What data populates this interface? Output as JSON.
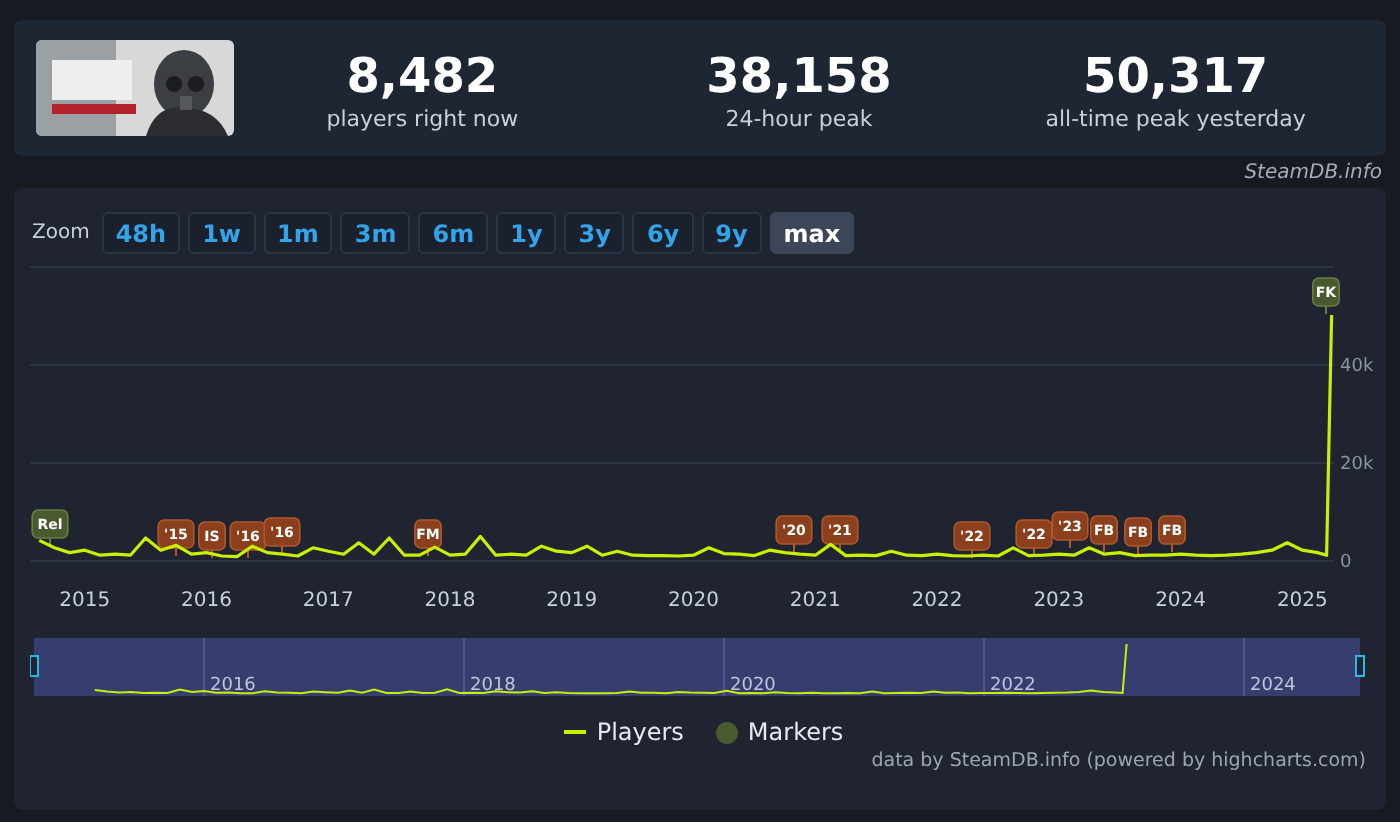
{
  "header": {
    "stats": [
      {
        "value": "8,482",
        "label": "players right now"
      },
      {
        "value": "38,158",
        "label": "24-hour peak"
      },
      {
        "value": "50,317",
        "label": "all-time peak yesterday"
      }
    ],
    "credit": "SteamDB.info"
  },
  "zoom": {
    "label": "Zoom",
    "buttons": [
      {
        "label": "48h",
        "selected": false
      },
      {
        "label": "1w",
        "selected": false
      },
      {
        "label": "1m",
        "selected": false
      },
      {
        "label": "3m",
        "selected": false
      },
      {
        "label": "6m",
        "selected": false
      },
      {
        "label": "1y",
        "selected": false
      },
      {
        "label": "3y",
        "selected": false
      },
      {
        "label": "6y",
        "selected": false
      },
      {
        "label": "9y",
        "selected": false
      },
      {
        "label": "max",
        "selected": true
      }
    ]
  },
  "chart": {
    "chart_data": {
      "type": "line",
      "x": [
        2014.625,
        2014.75,
        2014.875,
        2015,
        2015.125,
        2015.25,
        2015.375,
        2015.5,
        2015.625,
        2015.75,
        2015.875,
        2016,
        2016.125,
        2016.25,
        2016.375,
        2016.5,
        2016.625,
        2016.75,
        2016.875,
        2017,
        2017.125,
        2017.25,
        2017.375,
        2017.5,
        2017.625,
        2017.75,
        2017.875,
        2018,
        2018.125,
        2018.25,
        2018.375,
        2018.5,
        2018.625,
        2018.75,
        2018.875,
        2019,
        2019.125,
        2019.25,
        2019.375,
        2019.5,
        2019.625,
        2019.75,
        2019.875,
        2020,
        2020.125,
        2020.25,
        2020.375,
        2020.5,
        2020.625,
        2020.75,
        2020.875,
        2021,
        2021.125,
        2021.25,
        2021.375,
        2021.5,
        2021.625,
        2021.75,
        2021.875,
        2022,
        2022.125,
        2022.25,
        2022.375,
        2022.5,
        2022.625,
        2022.75,
        2022.875,
        2023,
        2023.125,
        2023.25,
        2023.375,
        2023.5,
        2023.625,
        2023.75,
        2023.875,
        2024,
        2024.125,
        2024.25,
        2024.375,
        2024.5,
        2024.625,
        2024.75,
        2024.875,
        2025,
        2025.125,
        2025.2,
        2025.24
      ],
      "series": [
        {
          "name": "Players",
          "color": "#c8f000",
          "values": [
            4000,
            2500,
            1500,
            2000,
            1000,
            1200,
            1000,
            4500,
            2000,
            3000,
            1200,
            1500,
            800,
            700,
            2800,
            1500,
            1200,
            800,
            2500,
            1800,
            1200,
            3500,
            1200,
            4500,
            1000,
            1000,
            2600,
            1000,
            1200,
            4800,
            1000,
            1200,
            1000,
            2800,
            1800,
            1500,
            2800,
            1000,
            1800,
            1000,
            900,
            900,
            800,
            1000,
            2500,
            1300,
            1200,
            900,
            2000,
            1500,
            1200,
            1000,
            3200,
            900,
            1000,
            900,
            1800,
            1000,
            900,
            1200,
            900,
            800,
            1000,
            800,
            2500,
            900,
            1000,
            1200,
            1000,
            2500,
            1200,
            1500,
            900,
            1000,
            1000,
            1200,
            1000,
            900,
            1000,
            1200,
            1500,
            2000,
            3500,
            2000,
            1500,
            1000,
            50000
          ]
        }
      ],
      "xlim": [
        2014.55,
        2025.26
      ],
      "ylim": [
        0,
        60000
      ],
      "yticks": [
        {
          "value": 0,
          "label": "0"
        },
        {
          "value": 20000,
          "label": "20k"
        },
        {
          "value": 40000,
          "label": "40k"
        }
      ],
      "xticks": [
        {
          "value": 2015,
          "label": "2015"
        },
        {
          "value": 2016,
          "label": "2016"
        },
        {
          "value": 2017,
          "label": "2017"
        },
        {
          "value": 2018,
          "label": "2018"
        },
        {
          "value": 2019,
          "label": "2019"
        },
        {
          "value": 2020,
          "label": "2020"
        },
        {
          "value": 2021,
          "label": "2021"
        },
        {
          "value": 2022,
          "label": "2022"
        },
        {
          "value": 2023,
          "label": "2023"
        },
        {
          "value": 2024,
          "label": "2024"
        },
        {
          "value": 2025,
          "label": "2025"
        }
      ]
    },
    "markers": [
      {
        "label": "Rel",
        "kind": "release"
      },
      {
        "label": "'15",
        "kind": "event"
      },
      {
        "label": "IS",
        "kind": "event"
      },
      {
        "label": "'16",
        "kind": "event"
      },
      {
        "label": "'16",
        "kind": "event"
      },
      {
        "label": "FM",
        "kind": "event"
      },
      {
        "label": "'20",
        "kind": "event"
      },
      {
        "label": "'21",
        "kind": "event"
      },
      {
        "label": "'22",
        "kind": "event"
      },
      {
        "label": "'22",
        "kind": "event"
      },
      {
        "label": "'23",
        "kind": "event"
      },
      {
        "label": "FB",
        "kind": "event"
      },
      {
        "label": "FB",
        "kind": "event"
      },
      {
        "label": "FB",
        "kind": "event"
      },
      {
        "label": "FK",
        "kind": "release"
      }
    ]
  },
  "navigator": {
    "labels": [
      "2016",
      "2018",
      "2020",
      "2022",
      "2024"
    ]
  },
  "legend": [
    {
      "kind": "line"
    },
    {
      "kind": "dot",
      "label": "Markers"
    }
  ],
  "footer": "data by SteamDB.info (powered by highcharts.com)"
}
